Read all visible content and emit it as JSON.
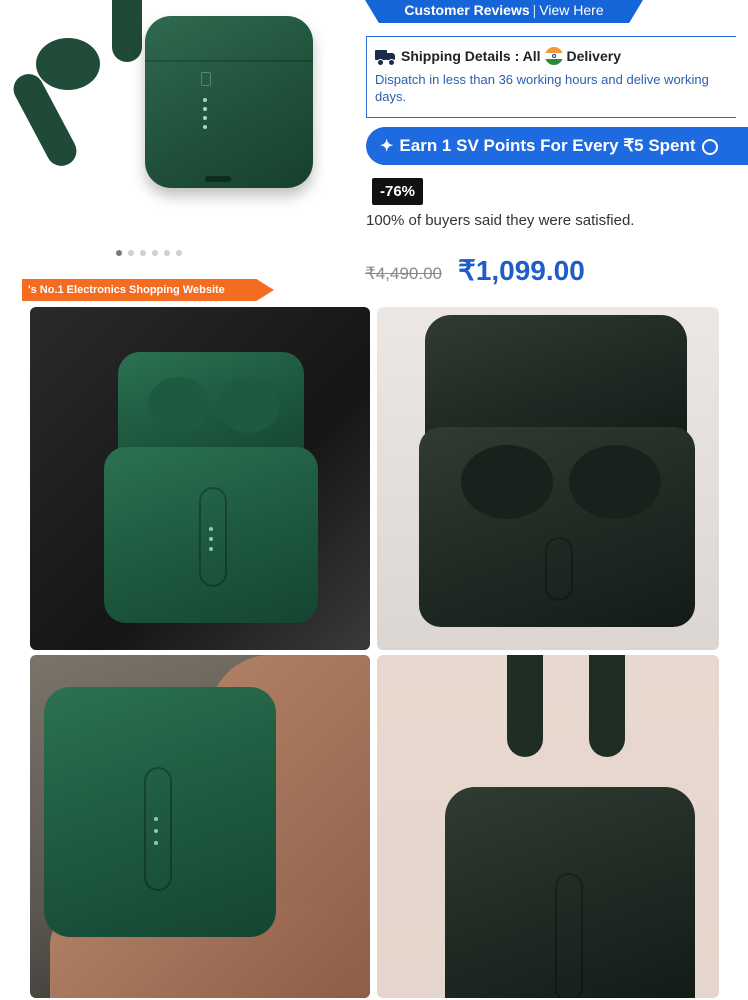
{
  "product": {
    "customer_reviews_label": "Customer Reviews",
    "view_here_label": "View Here",
    "image_dots": {
      "count": 6,
      "active_index": 0
    },
    "promo_banner": "'s No.1 Electronics Shopping Website"
  },
  "shipping": {
    "title_prefix": "Shipping Details : All",
    "title_suffix": "Delivery",
    "text": "Dispatch in less than 36 working hours and delive working days."
  },
  "points": {
    "text": "Earn 1 SV Points For Every ₹5 Spent"
  },
  "offer": {
    "discount": "-76%",
    "satisfaction": "100% of buyers said they were satisfied.",
    "mrp": "₹4,490.00",
    "price": "₹1,099.00"
  },
  "colors": {
    "accent_blue": "#1e6ae0",
    "price_blue": "#1e5dc8",
    "banner_orange": "#f36c1f",
    "case_green": "#1e5a40"
  },
  "icons": {
    "truck": "truck-icon",
    "flag": "india-flag-icon",
    "sparkle": "sparkle-icon",
    "info": "info-icon"
  }
}
